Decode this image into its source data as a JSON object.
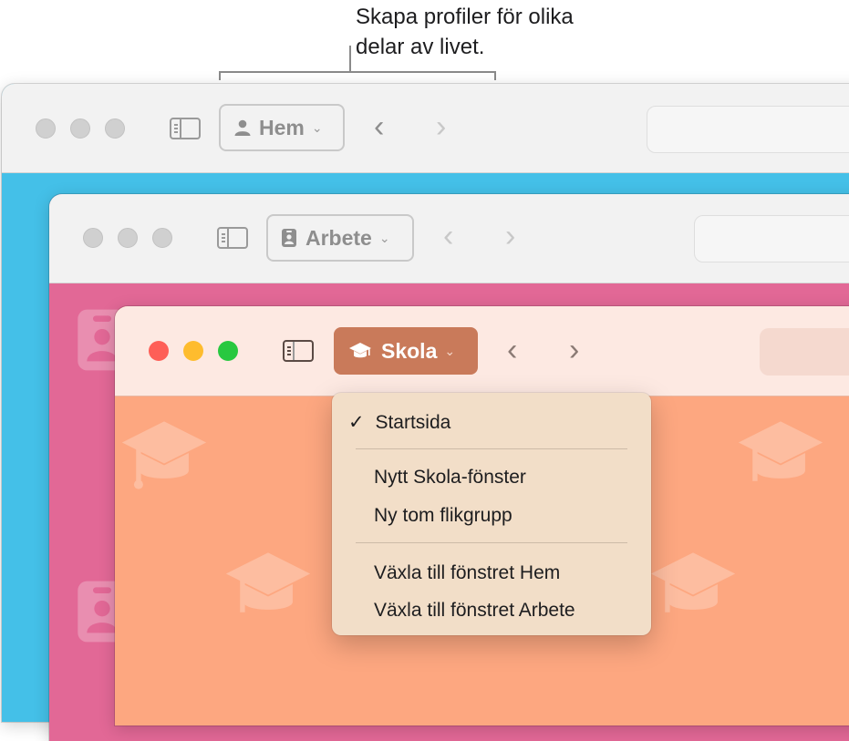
{
  "callout": {
    "line1": "Skapa profiler för olika",
    "line2": "delar av livet."
  },
  "windows": {
    "hem": {
      "profile_label": "Hem",
      "profile_icon": "person-icon",
      "color": "#44c0e8"
    },
    "arbete": {
      "profile_label": "Arbete",
      "profile_icon": "id-badge-icon",
      "color": "#e26896"
    },
    "skola": {
      "profile_label": "Skola",
      "profile_icon": "graduation-cap-icon",
      "color": "#fda780",
      "accent": "#c97a5a"
    }
  },
  "traffic_lights": {
    "close": "#fe5f57",
    "minimize": "#febc2e",
    "zoom": "#28c840"
  },
  "nav": {
    "back": "‹",
    "forward": "›",
    "chevron": "⌄"
  },
  "profile_menu": {
    "checkmark": "✓",
    "items": [
      "Startsida",
      "Nytt Skola-fönster",
      "Ny tom flikgrupp",
      "Växla till fönstret Hem",
      "Växla till fönstret Arbete"
    ]
  }
}
